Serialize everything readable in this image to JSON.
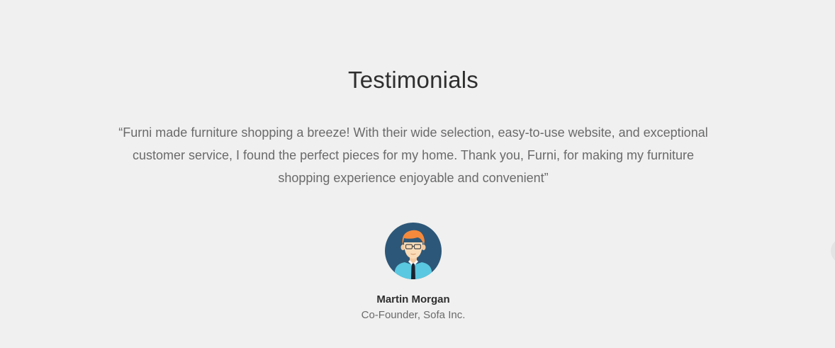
{
  "section": {
    "title": "Testimonials"
  },
  "testimonial": {
    "quote": "“Furni made furniture shopping a breeze! With their wide selection, easy-to-use website, and exceptional customer service, I found the perfect pieces for my home. Thank you, Furni, for making my furniture shopping experience enjoyable and convenient”",
    "author_name": "Martin Morgan",
    "author_role": "Co-Founder, Sofa Inc.",
    "avatar_icon": "person-avatar-icon"
  },
  "slider": {
    "next_icon": "next-arrow-icon"
  },
  "colors": {
    "background": "#eff0ef",
    "heading": "#2f2f2f",
    "body_text": "#6a6a6a",
    "avatar_bg": "#2d5778",
    "shirt": "#5ac8e0",
    "hair": "#f58a3c"
  }
}
